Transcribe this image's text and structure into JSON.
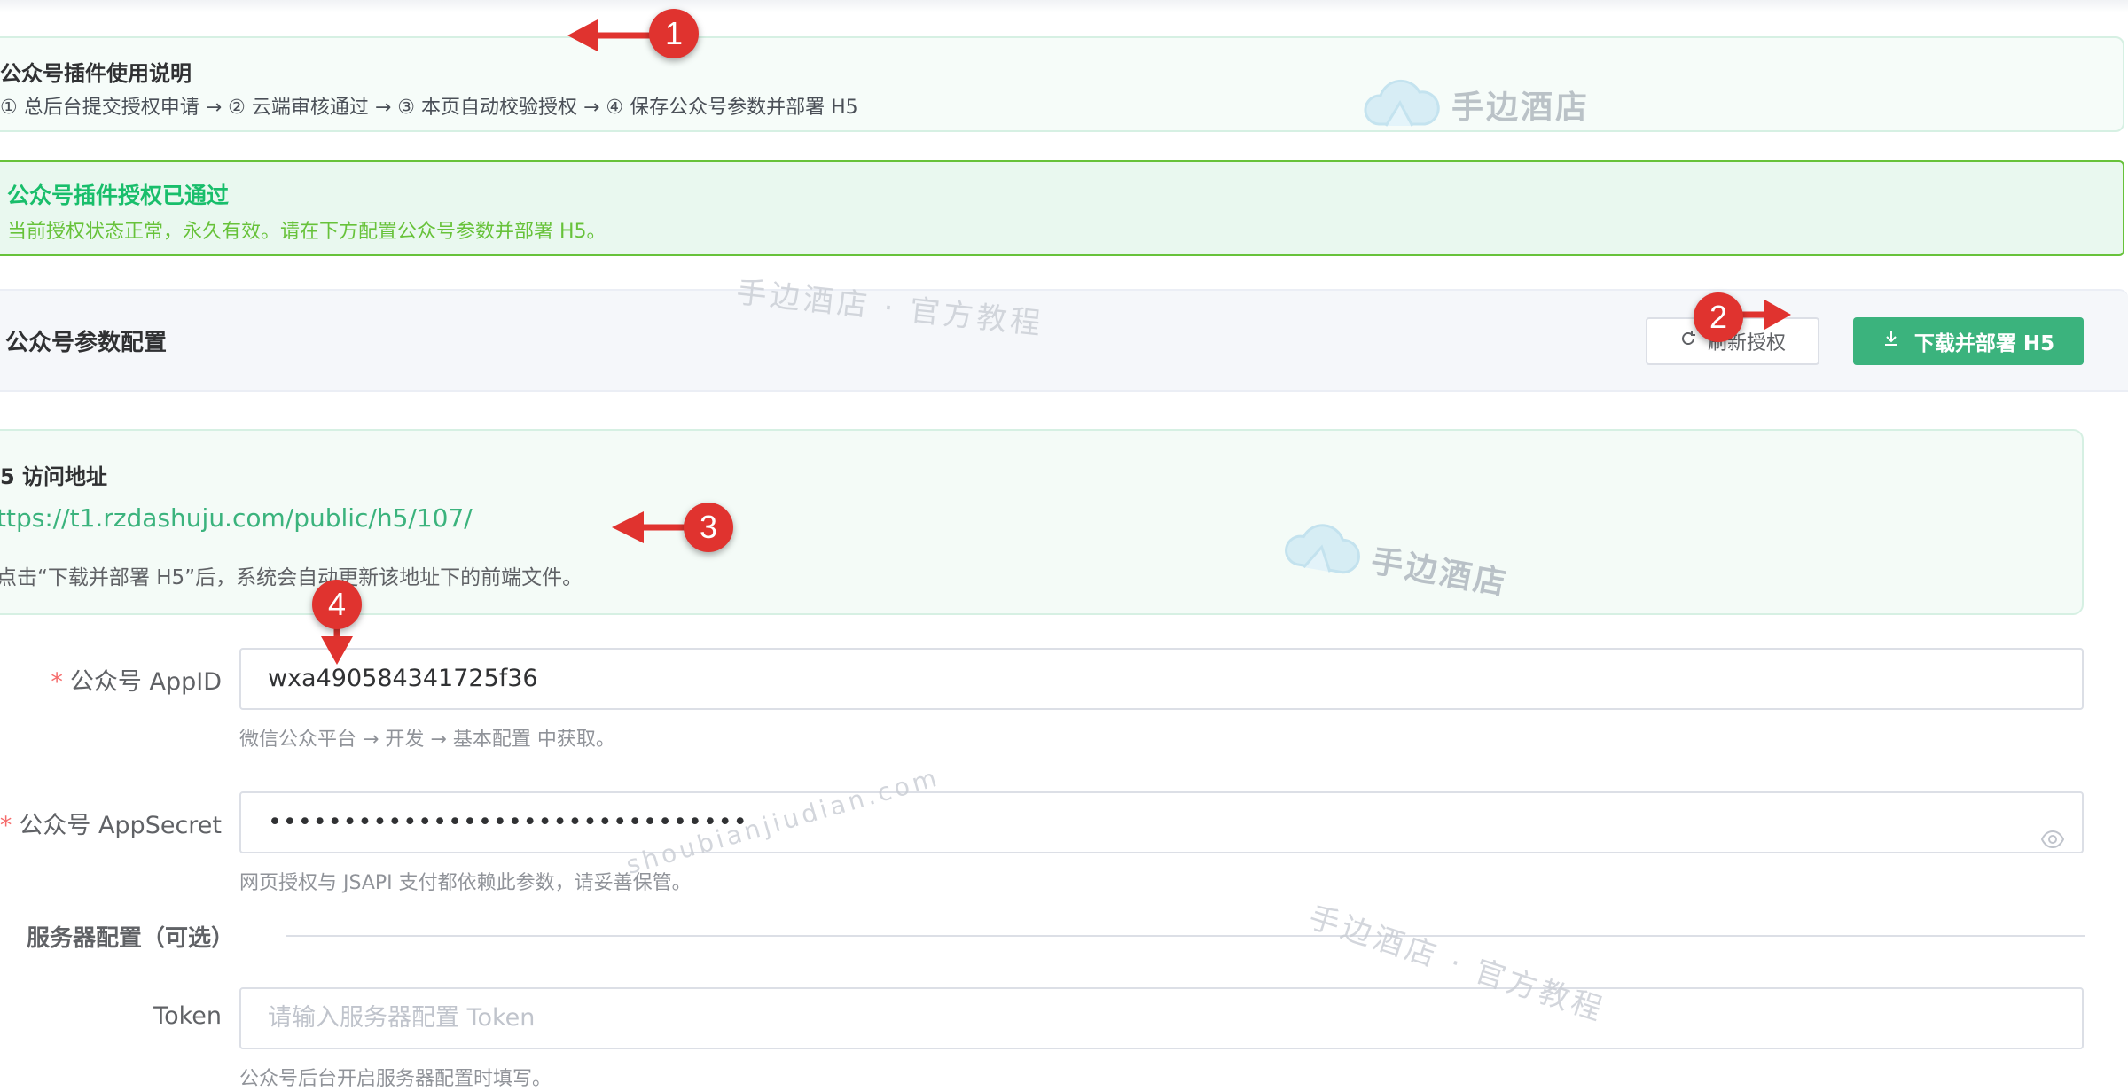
{
  "info": {
    "title": "公众号插件使用说明",
    "steps": "① 总后台提交授权申请 → ② 云端审核通过 → ③ 本页自动校验授权 → ④ 保存公众号参数并部署 H5"
  },
  "success": {
    "title": "公众号插件授权已通过",
    "desc": "当前授权状态正常，永久有效。请在下方配置公众号参数并部署 H5。"
  },
  "card": {
    "title": "公众号参数配置",
    "refresh_label": "刷新授权",
    "deploy_label": "下载并部署 H5"
  },
  "h5": {
    "title": "5 访问地址",
    "url": "ttps://t1.rzdashuju.com/public/h5/107/",
    "tip": "点击“下载并部署 H5”后，系统会自动更新该地址下的前端文件。"
  },
  "form": {
    "appid": {
      "label": "公众号 AppID",
      "value": "wxa490584341725f36",
      "help": "微信公众平台 → 开发 → 基本配置 中获取。"
    },
    "appsecret": {
      "label": "公众号 AppSecret",
      "value": "••••••••••••••••••••••••••••••••",
      "help": "网页授权与 JSAPI 支付都依赖此参数，请妥善保管。"
    },
    "server_section": "服务器配置（可选）",
    "token": {
      "label": "Token",
      "placeholder": "请输入服务器配置 Token",
      "help": "公众号后台开启服务器配置时填写。"
    }
  },
  "watermarks": {
    "brand": "手边酒店",
    "tutorial": "手边酒店 · 官方教程",
    "domain": "shoubianjiudian.com"
  },
  "annotations": [
    "1",
    "2",
    "3",
    "4"
  ],
  "colors": {
    "primary": "#3bb37d",
    "success_text": "#19be6b",
    "success_border": "#67c23a",
    "required": "#f56c6c",
    "annotation": "#e0332f"
  },
  "icons": [
    "refresh-icon",
    "download-icon",
    "eye-icon",
    "cloud-logo-icon"
  ]
}
